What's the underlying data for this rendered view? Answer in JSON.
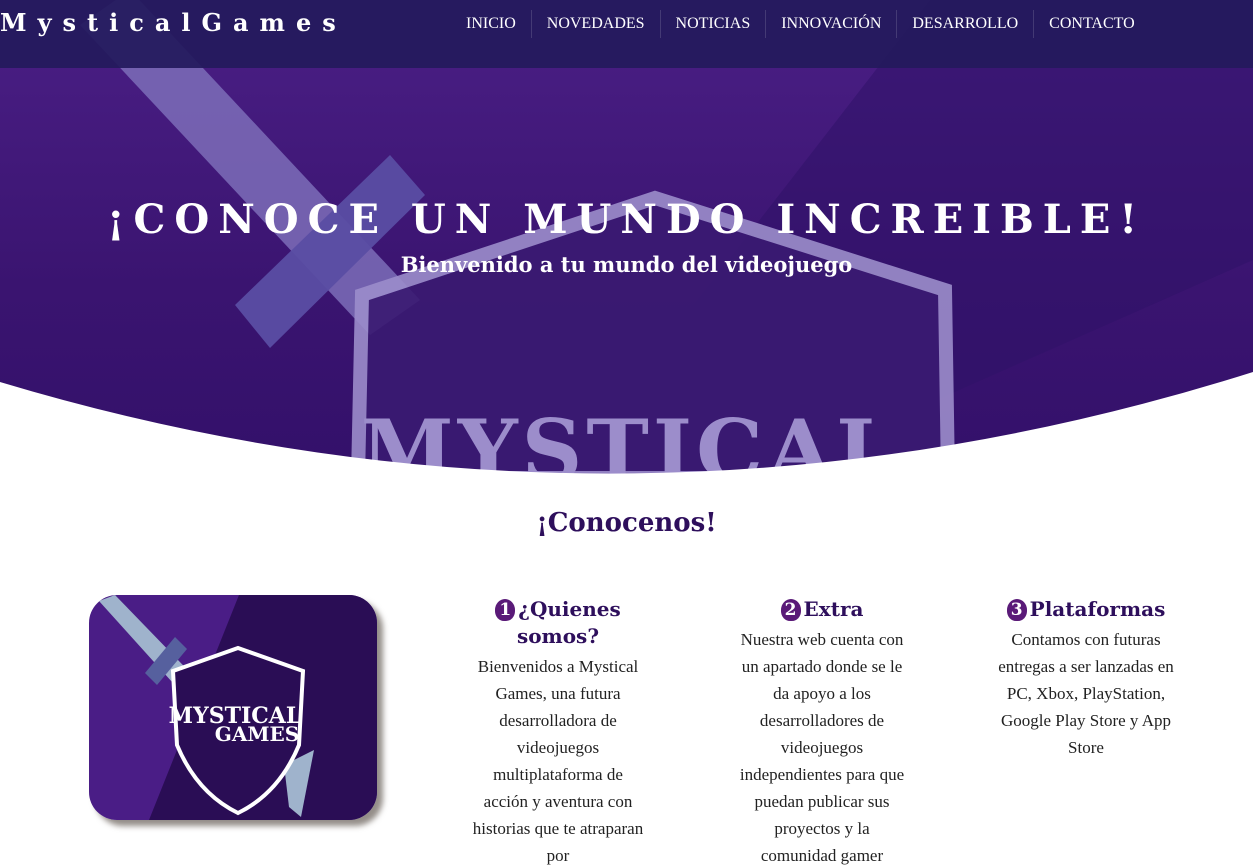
{
  "brand": {
    "name": "MysticalGames"
  },
  "nav": {
    "items": [
      {
        "label": "INICIO"
      },
      {
        "label": "NOVEDADES"
      },
      {
        "label": "NOTICIAS"
      },
      {
        "label": "INNOVACIÓN"
      },
      {
        "label": "DESARROLLO"
      },
      {
        "label": "CONTACTO"
      }
    ]
  },
  "hero": {
    "title": "¡CONOCE UN MUNDO INCREIBLE!",
    "subtitle": "Bienvenido a tu mundo del videojuego",
    "bg_logo_text": "MYSTICAL"
  },
  "about": {
    "title": "¡Conocenos!",
    "logo_text_line1": "MYSTICAL",
    "logo_text_line2": "GAMES",
    "columns": [
      {
        "number": "1",
        "title": "¿Quienes somos?",
        "text": "Bienvenidos a Mystical Games, una futura desarrolladora de videojuegos multiplataforma de acción y aventura con historias que te atraparan por"
      },
      {
        "number": "2",
        "title": "Extra",
        "text": "Nuestra web cuenta con un apartado donde se le da apoyo a los desarrolladores de videojuegos independientes para que puedan publicar sus proyectos y la comunidad gamer"
      },
      {
        "number": "3",
        "title": "Plataformas",
        "text": "Contamos con futuras entregas a ser lanzadas en PC, Xbox, PlayStation, Google Play Store y App Store"
      }
    ]
  },
  "colors": {
    "hero_purple": "#4b1f86",
    "nav_bg": "#231a5c",
    "heading": "#2e0f5c",
    "badge": "#5a1a78"
  }
}
